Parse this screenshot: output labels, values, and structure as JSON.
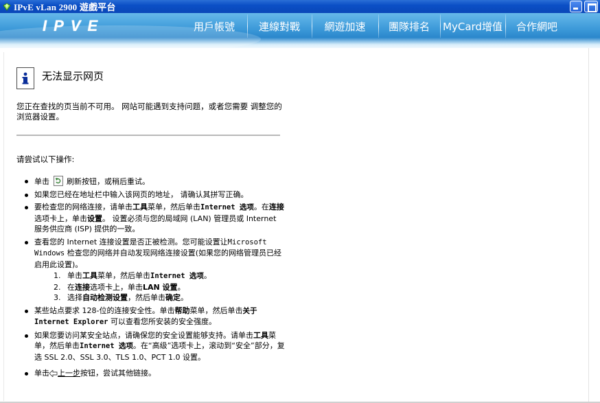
{
  "window": {
    "title": "IPvE vLan 2900 遊戲平台"
  },
  "header": {
    "logo_text": "IPVE",
    "nav": [
      {
        "label": "用戶帳號"
      },
      {
        "label": "連線對戰"
      },
      {
        "label": "網遊加速"
      },
      {
        "label": "團隊排名"
      },
      {
        "label": "MyCard增值"
      },
      {
        "label": "合作網吧"
      }
    ]
  },
  "page": {
    "title": "无法显示网页",
    "description": "您正在查找的页当前不可用。 网站可能遇到支持问题，或者您需要 调整您的浏览器设置。",
    "try_heading": "请尝试以下操作:",
    "tips": {
      "t1_pre": "单击",
      "t1_post": "刷新按钮，或稍后重试。",
      "t2": "如果您已经在地址栏中输入该网页的地址， 请确认其拼写正确。",
      "t3_a": "要检查您的网络连接，请单击",
      "t3_b": "工具",
      "t3_c": "菜单，然后单击",
      "t3_d": "Internet 选项",
      "t3_e": "。在",
      "t3_f": "连接",
      "t3_g": "选项卡上，单击",
      "t3_h": "设置",
      "t3_i": "。 设置必须与您的局域网 (LAN) 管理员或 Internet 服务供应商 (ISP) 提供的一致。",
      "t4_a": "查看您的 Internet 连接设置是否正被检测。您可能设置让",
      "t4_b": "Microsoft Windows",
      "t4_c": " 检查您的网络并自动发现网络连接设置(如果您的网络管理员已经启用此设置)。",
      "s1_num": "1.",
      "s1_a": "单击",
      "s1_b": "工具",
      "s1_c": "菜单，然后单击",
      "s1_d": "Internet 选项",
      "s1_e": "。",
      "s2_num": "2.",
      "s2_a": "在",
      "s2_b": "连接",
      "s2_c": "选项卡上，单击",
      "s2_d": "LAN 设置",
      "s2_e": "。",
      "s3_num": "3.",
      "s3_a": "选择",
      "s3_b": "自动检测设置",
      "s3_c": "，然后单击",
      "s3_d": "确定",
      "s3_e": "。",
      "t5_a": "某些站点要求 128-位的连接安全性。单击",
      "t5_b": "帮助",
      "t5_c": "菜单，然后单击",
      "t5_d": "关于 Internet Explorer",
      "t5_e": " 可以查看您所安装的安全强度。",
      "t6_a": "如果您要访问某安全站点，请确保您的安全设置能够支持。请单击",
      "t6_b": "工具",
      "t6_c": "菜单，然后单击",
      "t6_d": "Internet 选项",
      "t6_e": "。在“高级”选项卡上，滚动到“安全”部分，复选 SSL 2.0、SSL 3.0、TLS 1.0、PCT 1.0 设置。",
      "t7_a": "单击",
      "t7_link": "上一步",
      "t7_b": "按钮，尝试其他链接。"
    }
  }
}
